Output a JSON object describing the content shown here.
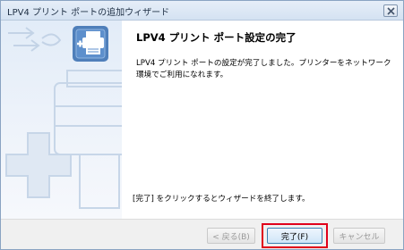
{
  "window": {
    "title": "LPV4 プリント ポートの追加ウィザード"
  },
  "main": {
    "heading": "LPV4 プリント ポート設定の完了",
    "description": "LPV4 プリント ポートの設定が完了しました。プリンターをネットワーク環境でご利用になれます。",
    "instruction": "[完了] をクリックするとウィザードを終了します。"
  },
  "buttons": {
    "back": "< 戻る(B)",
    "finish": "完了(F)",
    "cancel": "キャンセル"
  },
  "icons": {
    "close": "close-icon",
    "wizard": "network-printer-icon"
  },
  "colors": {
    "highlight": "#e0001a"
  }
}
